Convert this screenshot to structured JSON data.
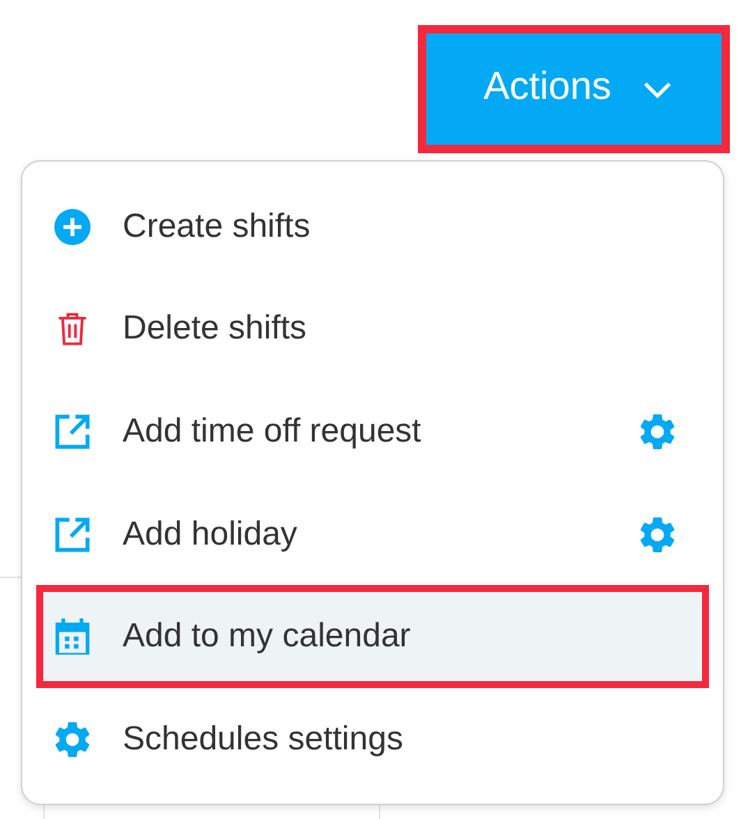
{
  "actions_button": {
    "label": "Actions",
    "highlighted": true
  },
  "menu": {
    "items": [
      {
        "label": "Create shifts",
        "kind": "create",
        "settings": false,
        "selected": false
      },
      {
        "label": "Delete shifts",
        "kind": "delete",
        "settings": false,
        "selected": false
      },
      {
        "label": "Add time off request",
        "kind": "link",
        "settings": true,
        "selected": false
      },
      {
        "label": "Add holiday",
        "kind": "link",
        "settings": true,
        "selected": false
      },
      {
        "label": "Add to my calendar",
        "kind": "calendar",
        "settings": false,
        "selected": true
      },
      {
        "label": "Schedules settings",
        "kind": "settings",
        "settings": false,
        "selected": false
      }
    ]
  }
}
